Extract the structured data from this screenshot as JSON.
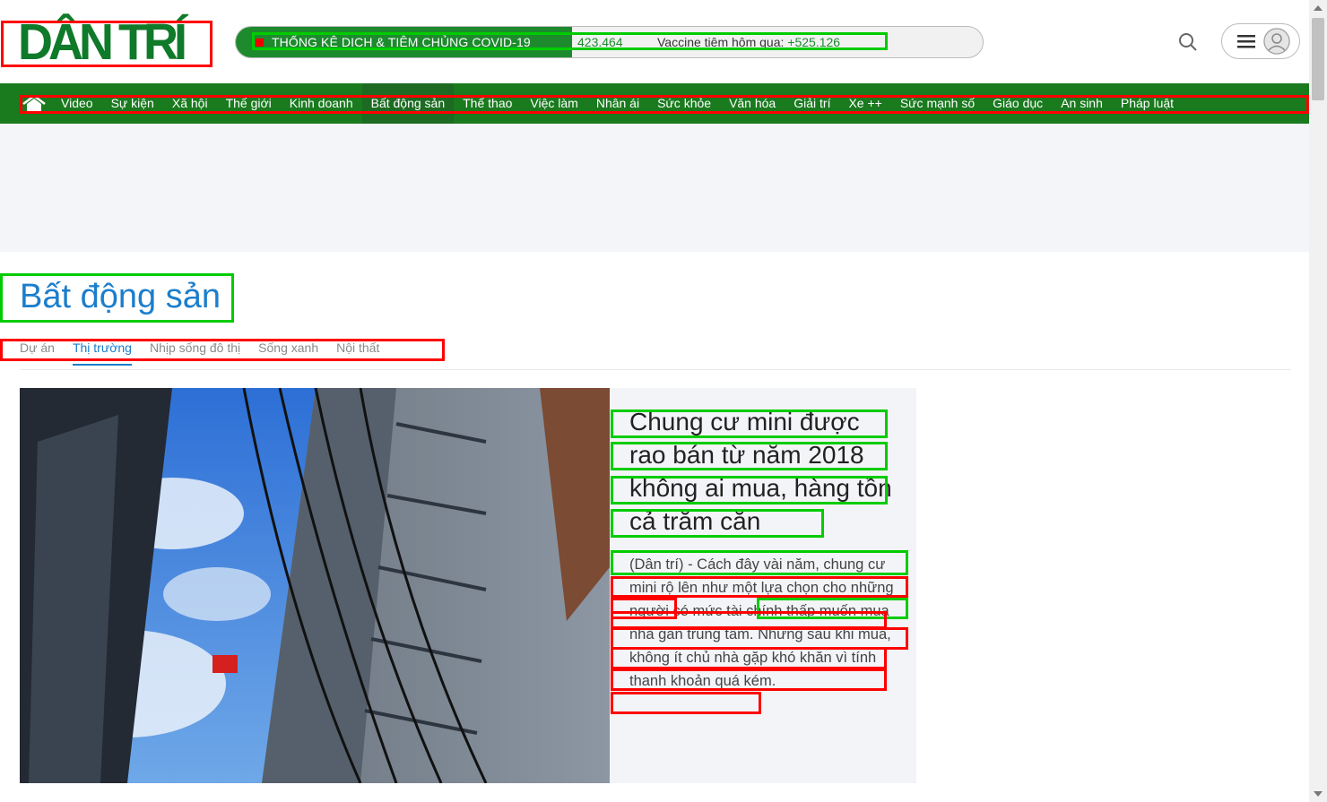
{
  "header": {
    "logo_text": "DÂN TRÍ",
    "covid": {
      "title": "THỐNG KÊ DỊCH & TIÊM CHỦNG COVID-19",
      "count": "423.464",
      "vaccine_label": "Vaccine tiêm hôm qua:",
      "vaccine_value": "+525.126"
    },
    "icons": {
      "search": "search-icon",
      "menu": "hamburger-menu-icon",
      "user": "user-avatar-icon"
    }
  },
  "nav": {
    "home_icon": "home-icon",
    "items": [
      "Video",
      "Sự kiện",
      "Xã hội",
      "Thế giới",
      "Kinh doanh",
      "Bất động sản",
      "Thể thao",
      "Việc làm",
      "Nhân ái",
      "Sức khỏe",
      "Văn hóa",
      "Giải trí",
      "Xe ++",
      "Sức mạnh số",
      "Giáo dục",
      "An sinh",
      "Pháp luật"
    ],
    "active": "Bất động sản"
  },
  "section": {
    "title": "Bất động sản",
    "subnav": [
      "Dự án",
      "Thị trường",
      "Nhịp sống đô thị",
      "Sống xanh",
      "Nội thất"
    ],
    "active_subnav": "Thị trường"
  },
  "feature": {
    "headline": "Chung cư mini được rao bán từ năm 2018 không ai mua, hàng tồn cả trăm căn",
    "lede": "(Dân trí) - Cách đây vài năm, chung cư mini rộ lên như một lựa chọn cho những người có mức tài chính thấp muốn mua nhà gần trung tâm. Nhưng sau khi mua, không ít chủ nhà gặp khó khăn vì tính thanh khoản quá kém."
  },
  "colors": {
    "brand_green": "#1a7a1e",
    "logo_green": "#0f7a29",
    "section_blue": "#1b7ecc",
    "annotation_green": "#00cc00",
    "annotation_red": "#ff0000"
  }
}
